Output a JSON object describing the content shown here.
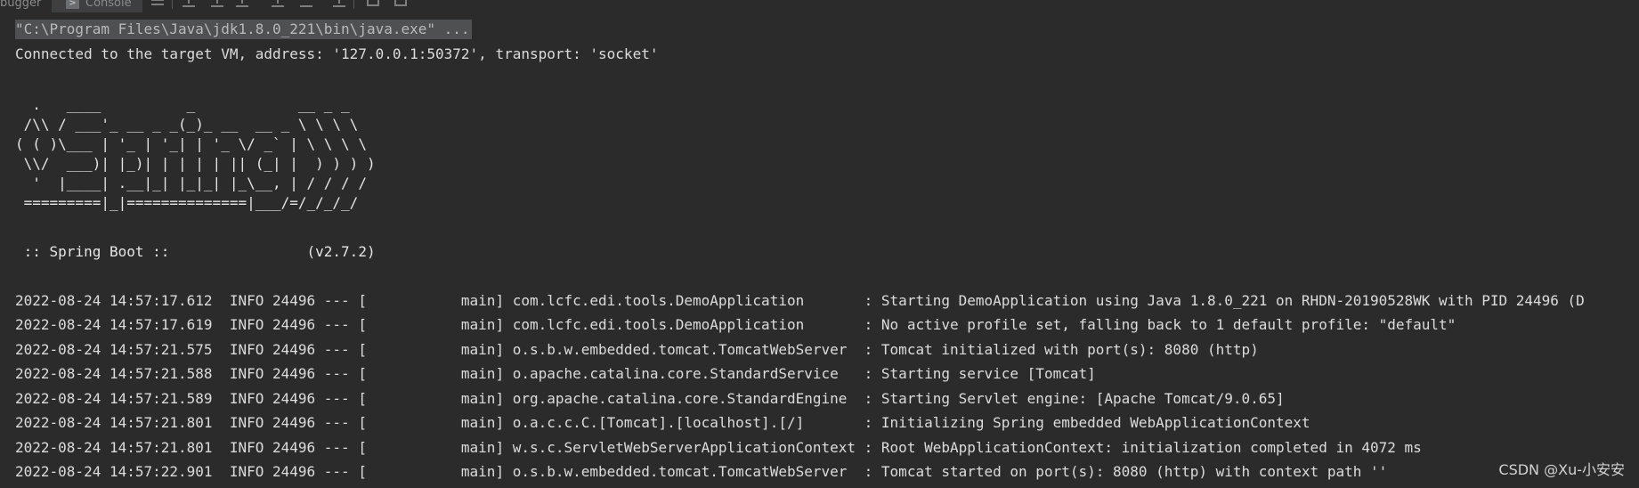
{
  "toolbar": {
    "debugger_tab_label": "bugger",
    "console_tab_label": "Console",
    "console_icon_glyph": ">",
    "icons": [
      "menu-icon",
      "scroll-up-icon",
      "download-icon",
      "scroll-down-icon",
      "clear-icon",
      "restore-icon",
      "filter-icon",
      "table-icon",
      "layout-icon"
    ]
  },
  "console": {
    "command_line": "\"C:\\Program Files\\Java\\jdk1.8.0_221\\bin\\java.exe\" ...",
    "connected_line": "Connected to the target VM, address: '127.0.0.1:50372', transport: 'socket'",
    "banner": [
      "  .   ____          _            __ _ _",
      " /\\\\ / ___'_ __ _ _(_)_ __  __ _ \\ \\ \\ \\",
      "( ( )\\___ | '_ | '_| | '_ \\/ _` | \\ \\ \\ \\",
      " \\\\/  ___)| |_)| | | | | || (_| |  ) ) ) )",
      "  '  |____| .__|_| |_|_| |_\\__, | / / / /",
      " =========|_|==============|___/=/_/_/_/",
      " :: Spring Boot ::                (v2.7.2)"
    ],
    "log_lines": [
      "2022-08-24 14:57:17.612  INFO 24496 --- [           main] com.lcfc.edi.tools.DemoApplication       : Starting DemoApplication using Java 1.8.0_221 on RHDN-20190528WK with PID 24496 (D",
      "2022-08-24 14:57:17.619  INFO 24496 --- [           main] com.lcfc.edi.tools.DemoApplication       : No active profile set, falling back to 1 default profile: \"default\"",
      "2022-08-24 14:57:21.575  INFO 24496 --- [           main] o.s.b.w.embedded.tomcat.TomcatWebServer  : Tomcat initialized with port(s): 8080 (http)",
      "2022-08-24 14:57:21.588  INFO 24496 --- [           main] o.apache.catalina.core.StandardService   : Starting service [Tomcat]",
      "2022-08-24 14:57:21.589  INFO 24496 --- [           main] org.apache.catalina.core.StandardEngine  : Starting Servlet engine: [Apache Tomcat/9.0.65]",
      "2022-08-24 14:57:21.801  INFO 24496 --- [           main] o.a.c.c.C.[Tomcat].[localhost].[/]       : Initializing Spring embedded WebApplicationContext",
      "2022-08-24 14:57:21.801  INFO 24496 --- [           main] w.s.c.ServletWebServerApplicationContext : Root WebApplicationContext: initialization completed in 4072 ms",
      "2022-08-24 14:57:22.901  INFO 24496 --- [           main] o.s.b.w.embedded.tomcat.TomcatWebServer  : Tomcat started on port(s): 8080 (http) with context path ''"
    ]
  },
  "watermark": "CSDN @Xu-小安安",
  "colors": {
    "background": "#2b2b2b",
    "text": "#dcdcdc",
    "command_highlight": "#4e5052"
  }
}
